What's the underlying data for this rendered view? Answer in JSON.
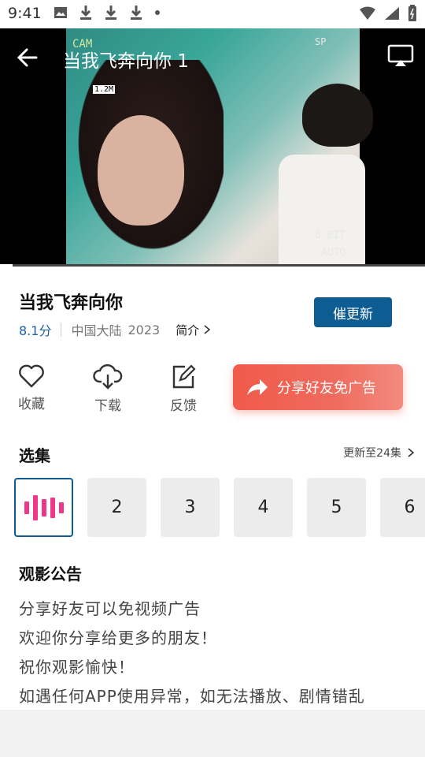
{
  "status_bar": {
    "time": "9:41"
  },
  "player": {
    "title": "当我飞奔向你 1",
    "overlay": {
      "cam": "CAM",
      "bitrate": "1.2M",
      "bit_depth": "8 BIT",
      "iso": "AUTO",
      "sp": "SP"
    },
    "progress": 0.03
  },
  "show": {
    "title": "当我飞奔向你",
    "score": "8.1分",
    "region": "中国大陆",
    "year": "2023",
    "intro_label": "简介",
    "urge_button": "催更新"
  },
  "actions": {
    "favorite": "收藏",
    "download": "下载",
    "feedback": "反馈",
    "share_banner": "分享好友免广告"
  },
  "episodes": {
    "title": "选集",
    "update_info": "更新至24集",
    "items": [
      "1",
      "2",
      "3",
      "4",
      "5",
      "6"
    ]
  },
  "notice": {
    "title": "观影公告",
    "lines": [
      "分享好友可以免视频广告",
      "欢迎你分享给更多的朋友！",
      "祝你观影愉快！",
      "如遇任何APP使用异常，如无法播放、剧情错乱"
    ]
  },
  "colors": {
    "accent": "#0d5c92",
    "score": "#1f5fa8",
    "share": "#f05a4a",
    "playing": "#f0378a"
  }
}
